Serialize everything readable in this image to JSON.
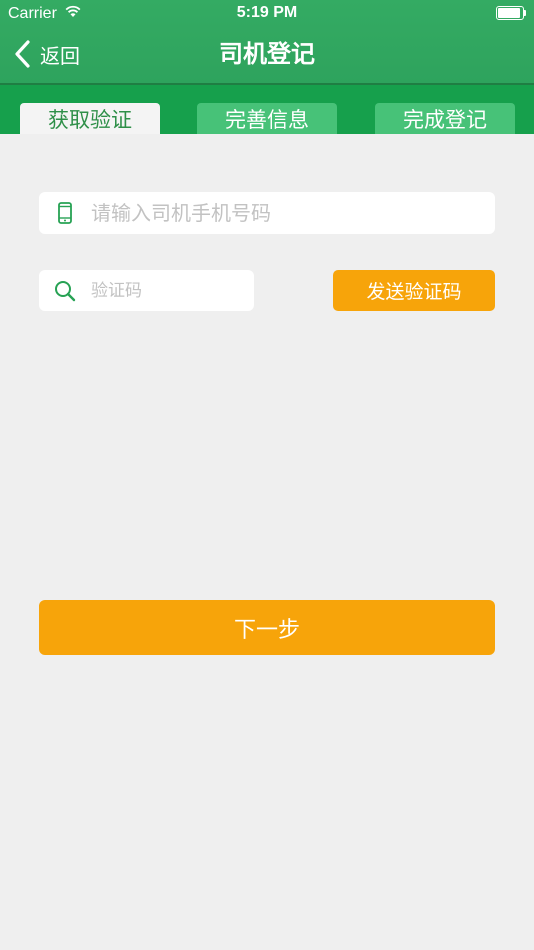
{
  "status_bar": {
    "carrier": "Carrier",
    "time": "5:19 PM",
    "battery_level": 1.0
  },
  "nav": {
    "back_label": "返回",
    "title": "司机登记"
  },
  "tabs": [
    {
      "label": "获取验证",
      "active": true
    },
    {
      "label": "完善信息",
      "active": false
    },
    {
      "label": "完成登记",
      "active": false
    }
  ],
  "form": {
    "phone_placeholder": "请输入司机手机号码",
    "phone_value": "",
    "code_placeholder": "验证码",
    "code_value": "",
    "send_code_label": "发送验证码",
    "next_label": "下一步"
  },
  "colors": {
    "header_green": "#2ea35d",
    "tabs_green": "#16a04c",
    "accent_orange": "#f7a40a",
    "background": "#efefef"
  },
  "icons": {
    "back": "chevron-left-icon",
    "phone": "phone-icon",
    "search": "search-icon",
    "wifi": "wifi-icon",
    "battery": "battery-icon"
  }
}
